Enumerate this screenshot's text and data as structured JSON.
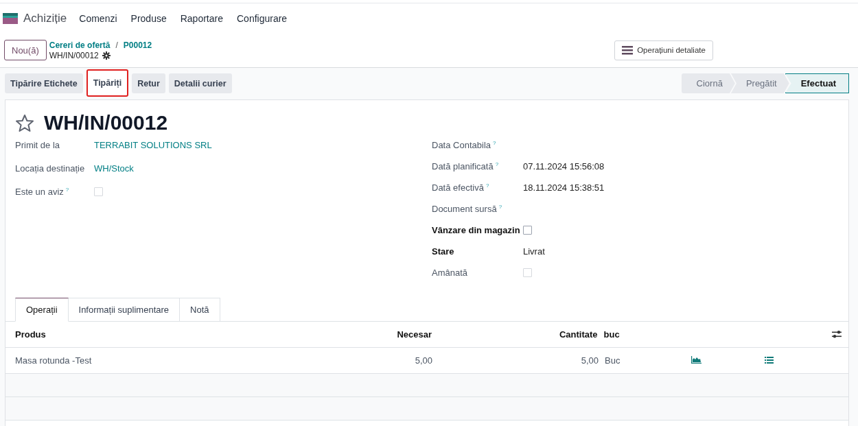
{
  "navbar": {
    "app_name": "Achiziție",
    "menu": [
      "Comenzi",
      "Produse",
      "Raportare",
      "Configurare"
    ]
  },
  "control_panel": {
    "new_button": "Nou(ă)",
    "breadcrumbs": [
      "Cereri de ofertă",
      "P00012"
    ],
    "breadcrumb_separator": "/",
    "record": "WH/IN/00012",
    "detail_button": "Operațiuni detaliate"
  },
  "actions": [
    {
      "label": "Tipărire Etichete",
      "highlighted": false
    },
    {
      "label": "Tipăriți",
      "highlighted": true
    },
    {
      "label": "Retur",
      "highlighted": false
    },
    {
      "label": "Detalii curier",
      "highlighted": false
    }
  ],
  "stages": [
    {
      "label": "Ciornă",
      "selected": false
    },
    {
      "label": "Pregătit",
      "selected": false
    },
    {
      "label": "Efectuat",
      "selected": true
    }
  ],
  "form": {
    "title": "WH/IN/00012",
    "starred": false,
    "left_fields": [
      {
        "label": "Primit de la",
        "kind": "link",
        "value": "TERRABIT SOLUTIONS SRL"
      },
      {
        "label": "Locația destinație",
        "kind": "link",
        "value": "WH/Stock"
      },
      {
        "label": "Este un aviz",
        "help": "?",
        "kind": "checkbox",
        "checked": false,
        "disabled": true
      }
    ],
    "right_fields": [
      {
        "label": "Data Contabila",
        "help": "?",
        "emphasized": false,
        "kind": "empty"
      },
      {
        "label": "Dată planificată",
        "help": "?",
        "emphasized": false,
        "kind": "text",
        "value": "07.11.2024 15:56:08"
      },
      {
        "label": "Dată efectivă",
        "help": "?",
        "emphasized": false,
        "kind": "text",
        "value": "18.11.2024 15:38:51"
      },
      {
        "label": "Document sursă",
        "help": "?",
        "emphasized": false,
        "kind": "empty"
      },
      {
        "label": "Vânzare din magazin",
        "emphasized": true,
        "kind": "checkbox",
        "checked": false,
        "disabled": false
      },
      {
        "label": "Stare",
        "emphasized": true,
        "kind": "text",
        "value": "Livrat"
      },
      {
        "label": "Amânată",
        "emphasized": false,
        "kind": "checkbox",
        "checked": false,
        "disabled": true
      }
    ]
  },
  "tabs": [
    {
      "label": "Operații",
      "selected": true
    },
    {
      "label": "Informații suplimentare",
      "selected": false
    },
    {
      "label": "Notă",
      "selected": false
    }
  ],
  "table": {
    "columns": [
      "Produs",
      "Necesar",
      "Cantitate",
      "buc"
    ],
    "rows": [
      {
        "product": "Masa rotunda -Test",
        "required": "5,00",
        "quantity": "5,00",
        "uom": "Buc"
      }
    ]
  }
}
